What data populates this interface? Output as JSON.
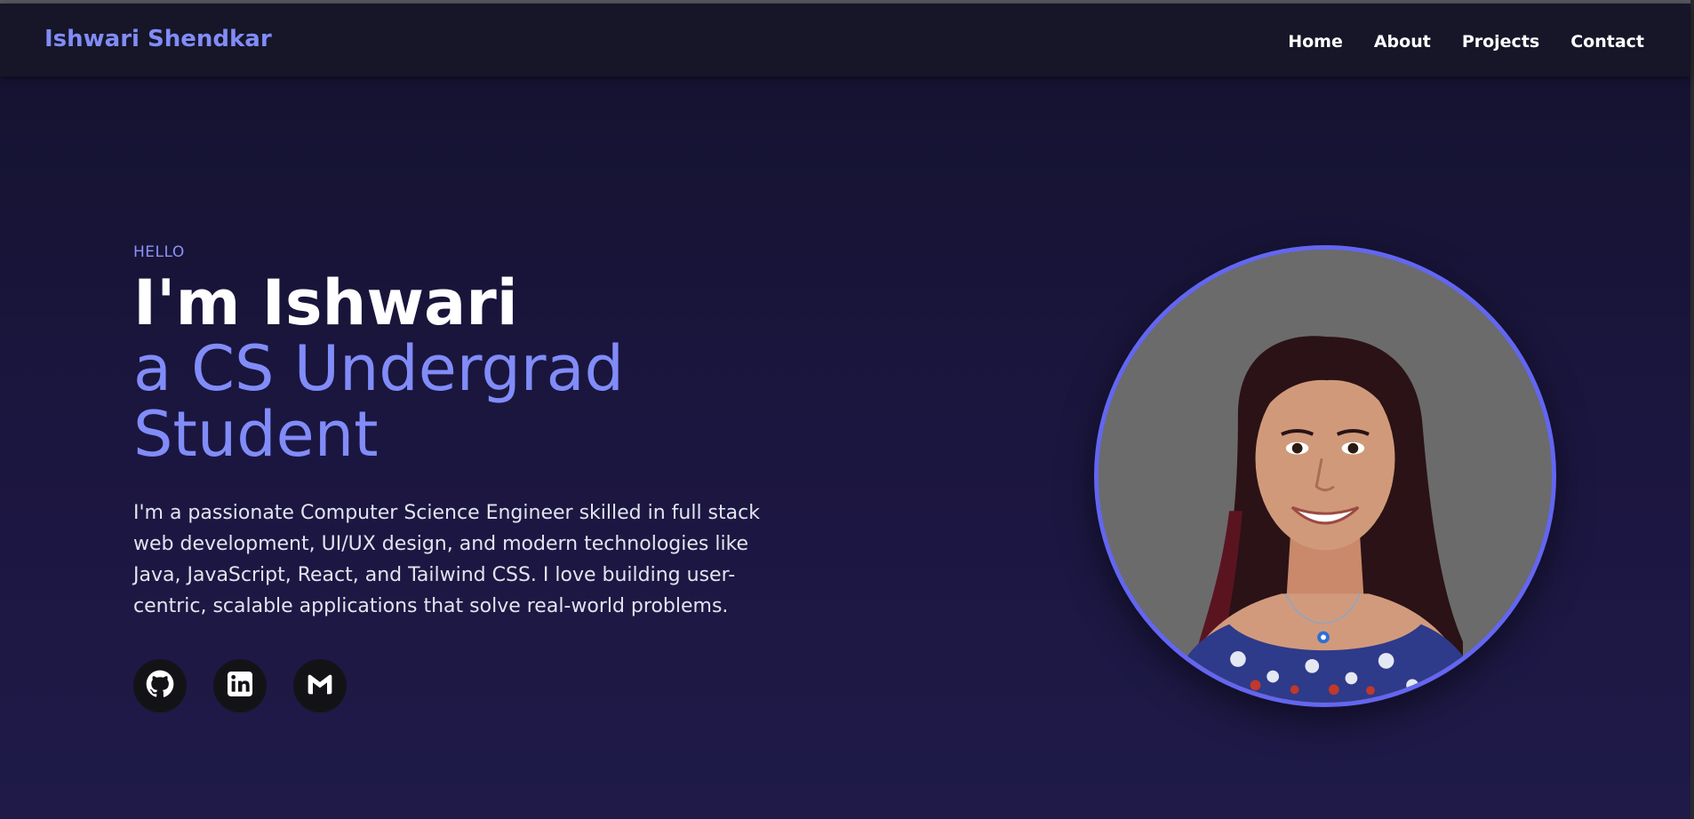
{
  "header": {
    "brand": "Ishwari Shendkar",
    "nav": [
      "Home",
      "About",
      "Projects",
      "Contact"
    ]
  },
  "hero": {
    "greeting": "HELLO",
    "name_line": "I'm Ishwari",
    "role_line_1": "a CS Undergrad",
    "role_line_2": "Student",
    "bio": "I'm a passionate Computer Science Engineer skilled in full stack web development, UI/UX design, and modern technologies like Java, JavaScript, React, and Tailwind CSS. I love building user-centric, scalable applications that solve real-world problems."
  },
  "socials": [
    {
      "icon": "github-icon"
    },
    {
      "icon": "linkedin-icon"
    },
    {
      "icon": "gmail-icon"
    }
  ],
  "colors": {
    "accent": "#818cf8",
    "avatar_border": "#6366f1",
    "background": "#1b1640",
    "navbar": "#161628"
  }
}
